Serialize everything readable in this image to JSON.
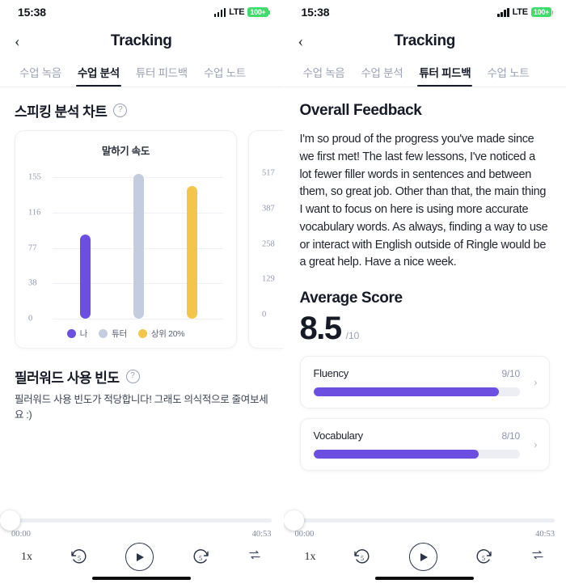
{
  "status_bar": {
    "time": "15:38",
    "network": "LTE",
    "battery": "100+",
    "signal_icon": "signal-bars-icon",
    "battery_icon": "battery-icon"
  },
  "nav": {
    "back_icon": "chevron-left-icon",
    "title": "Tracking"
  },
  "tabs": [
    {
      "label": "수업 녹음",
      "active_left": false,
      "active_right": false
    },
    {
      "label": "수업 분석",
      "active_left": true,
      "active_right": false
    },
    {
      "label": "튜터 피드백",
      "active_left": false,
      "active_right": true
    },
    {
      "label": "수업 노트",
      "active_left": false,
      "active_right": false
    }
  ],
  "left_panel": {
    "speaking_section": {
      "title": "스피킹 분석 차트",
      "help_icon": "question-mark-icon"
    },
    "filler_section": {
      "title": "필러워드 사용 빈도",
      "help_icon": "question-mark-icon",
      "description": "필러워드 사용 빈도가 적당합니다! 그래도 의식적으로 줄여보세요 :)"
    }
  },
  "chart_data": [
    {
      "type": "bar",
      "title": "말하기 속도",
      "categories": [
        "나",
        "튜터",
        "상위 20%"
      ],
      "values": [
        85,
        150,
        137
      ],
      "ytick_labels": [
        "155",
        "116",
        "77",
        "38",
        "0"
      ],
      "ylim": [
        0,
        155
      ],
      "grid": true,
      "legend": [
        {
          "label": "나",
          "color": "#6c4ee0"
        },
        {
          "label": "튜터",
          "color": "#c4cde0"
        },
        {
          "label": "상위 20%",
          "color": "#f3c64b"
        }
      ],
      "legend_position": "bottom",
      "xlabel": "",
      "ylabel": ""
    },
    {
      "type": "bar",
      "title": "",
      "categories": [],
      "values": [],
      "ytick_labels": [
        "517",
        "387",
        "258",
        "129",
        "0"
      ],
      "ylim": [
        0,
        517
      ],
      "grid": true,
      "legend": [],
      "note": "partially visible card clipped at right screen edge",
      "xlabel": "",
      "ylabel": ""
    }
  ],
  "right_panel": {
    "feedback": {
      "title": "Overall Feedback",
      "body": "I'm so proud of the progress you've made since we first met! The last few lessons, I've noticed a lot fewer filler words in sentences and between them, so great job. Other than that, the main thing I want to focus on here is using more accurate vocabulary words. As always, finding a way to use or interact with English outside of Ringle would be a great help. Have a nice week."
    },
    "average": {
      "title": "Average Score",
      "value": "8.5",
      "denominator": "/10"
    },
    "scores": [
      {
        "label": "Fluency",
        "score": "9/10",
        "percent": 90,
        "chevron_icon": "chevron-right-icon"
      },
      {
        "label": "Vocabulary",
        "score": "8/10",
        "percent": 80,
        "chevron_icon": "chevron-right-icon"
      }
    ]
  },
  "player": {
    "current_time": "00:00",
    "total_time": "40:53",
    "speed": "1x",
    "rewind_label": "5",
    "forward_label": "5",
    "play_icon": "play-icon",
    "rewind_icon": "rewind-5-icon",
    "forward_icon": "forward-5-icon",
    "loop_icon": "repeat-icon",
    "progress_percent": 0
  },
  "colors": {
    "accent_purple": "#6c4ee0",
    "tutor_gray": "#c4cde0",
    "top20_yellow": "#f3c64b",
    "text_dark": "#151a26",
    "text_muted": "#9aa1b5",
    "battery_green": "#3ddc6b"
  }
}
